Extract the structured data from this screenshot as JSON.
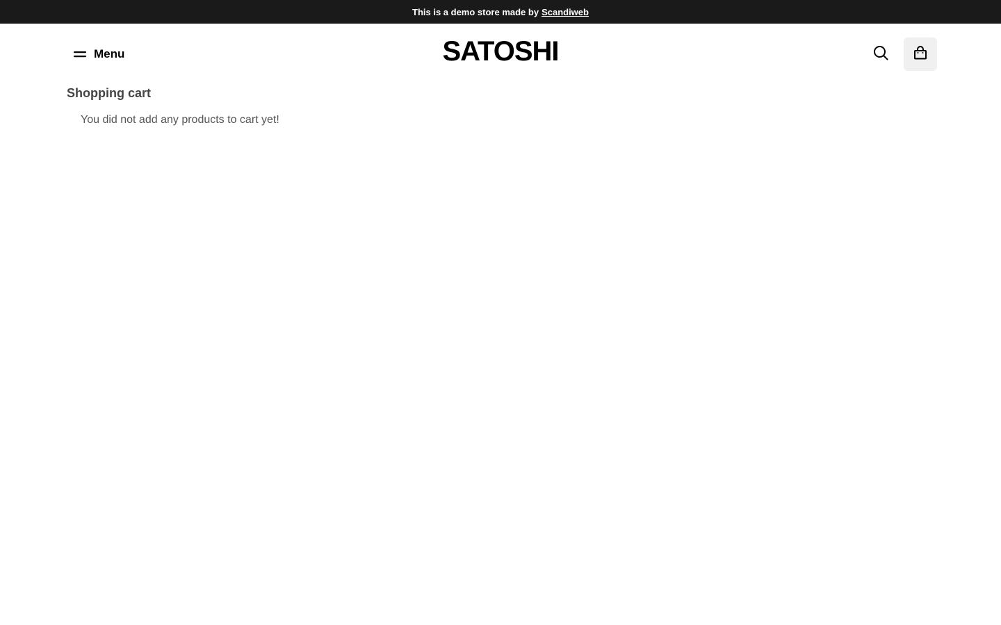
{
  "promo": {
    "text": "This is a demo store made by",
    "link_label": "Scandiweb"
  },
  "header": {
    "menu_label": "Menu",
    "menu_icon": "hamburger-icon",
    "logo": "SATOSHI",
    "search_icon": "search-icon",
    "cart_icon": "shopping-bag-icon"
  },
  "cart": {
    "title": "Shopping cart",
    "empty_message": "You did not add any products to cart yet!"
  },
  "colors": {
    "promo_bg": "#1a1a1a",
    "cart_button_bg": "#f0f0f0",
    "title_text": "#444444"
  }
}
